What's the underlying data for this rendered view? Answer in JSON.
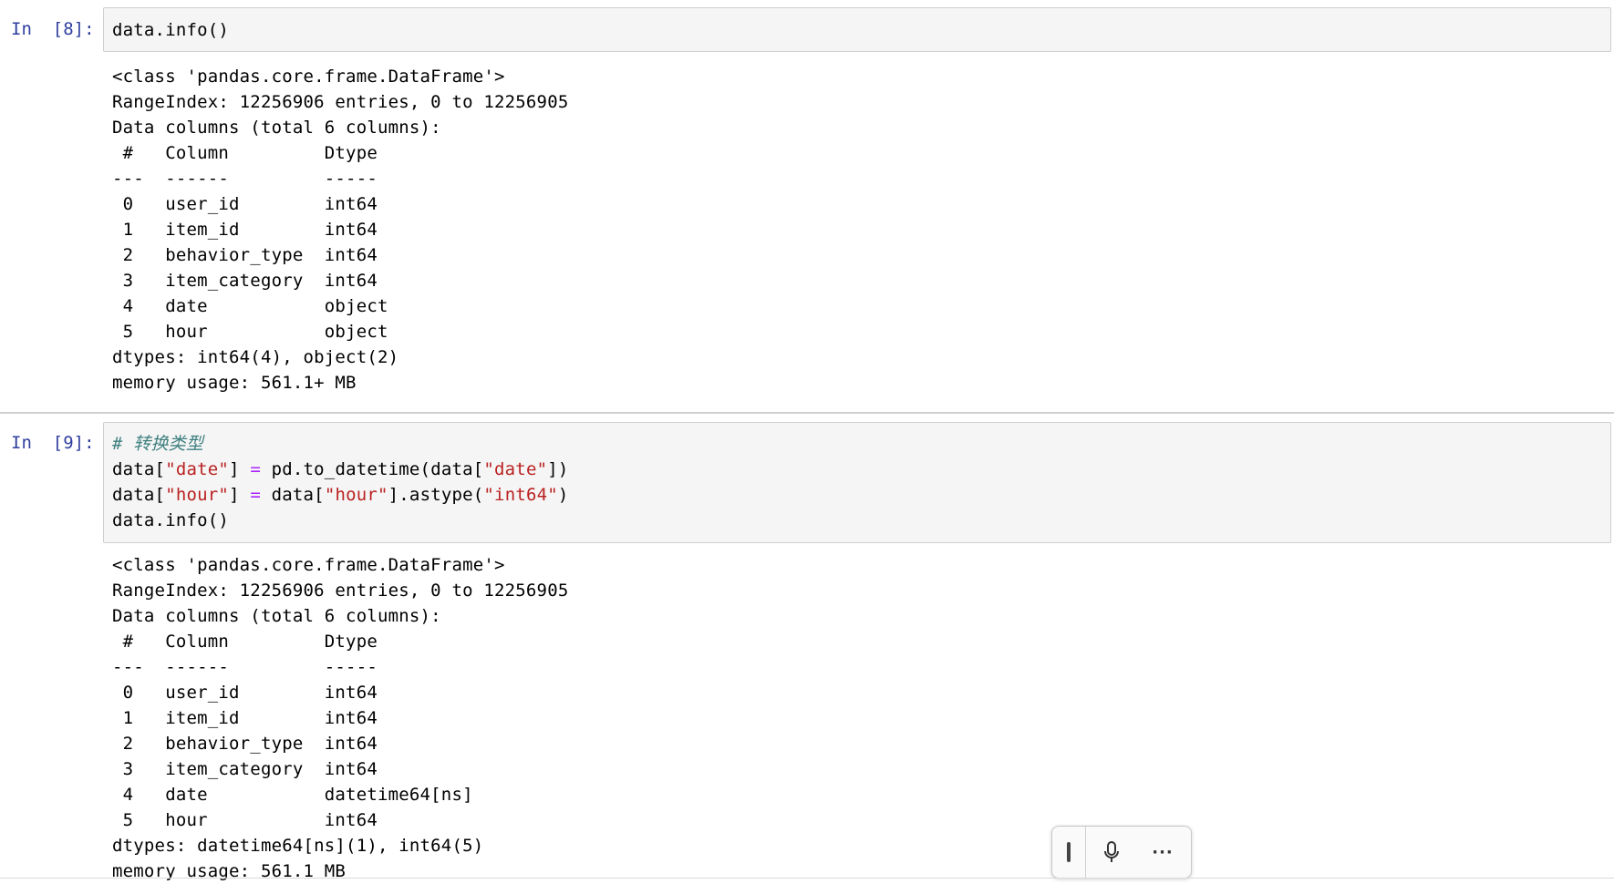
{
  "cells": [
    {
      "prompt": "In  [8]:",
      "input_lines": [
        [
          {
            "t": "data.info()",
            "c": ""
          }
        ]
      ],
      "output_lines": [
        "<class 'pandas.core.frame.DataFrame'>",
        "RangeIndex: 12256906 entries, 0 to 12256905",
        "Data columns (total 6 columns):",
        " #   Column         Dtype ",
        "---  ------         ----- ",
        " 0   user_id        int64 ",
        " 1   item_id        int64 ",
        " 2   behavior_type  int64 ",
        " 3   item_category  int64 ",
        " 4   date           object",
        " 5   hour           object",
        "dtypes: int64(4), object(2)",
        "memory usage: 561.1+ MB"
      ]
    },
    {
      "prompt": "In  [9]:",
      "input_lines": [
        [
          {
            "t": "# 转换类型",
            "c": "cm-comment"
          }
        ],
        [
          {
            "t": "data[",
            "c": ""
          },
          {
            "t": "\"date\"",
            "c": "cm-string"
          },
          {
            "t": "] ",
            "c": ""
          },
          {
            "t": "=",
            "c": "cm-op"
          },
          {
            "t": " pd.to_datetime(data[",
            "c": ""
          },
          {
            "t": "\"date\"",
            "c": "cm-string"
          },
          {
            "t": "])",
            "c": ""
          }
        ],
        [
          {
            "t": "data[",
            "c": ""
          },
          {
            "t": "\"hour\"",
            "c": "cm-string"
          },
          {
            "t": "] ",
            "c": ""
          },
          {
            "t": "=",
            "c": "cm-op"
          },
          {
            "t": " data[",
            "c": ""
          },
          {
            "t": "\"hour\"",
            "c": "cm-string"
          },
          {
            "t": "].astype(",
            "c": ""
          },
          {
            "t": "\"int64\"",
            "c": "cm-string"
          },
          {
            "t": ")",
            "c": ""
          }
        ],
        [
          {
            "t": "data.info()",
            "c": ""
          }
        ]
      ],
      "output_lines": [
        "<class 'pandas.core.frame.DataFrame'>",
        "RangeIndex: 12256906 entries, 0 to 12256905",
        "Data columns (total 6 columns):",
        " #   Column         Dtype         ",
        "---  ------         -----         ",
        " 0   user_id        int64         ",
        " 1   item_id        int64         ",
        " 2   behavior_type  int64         ",
        " 3   item_category  int64         ",
        " 4   date           datetime64[ns]",
        " 5   hour           int64         ",
        "dtypes: datetime64[ns](1), int64(5)",
        "memory usage: 561.1 MB"
      ]
    }
  ],
  "toolbar": {
    "handle_icon": "drag-handle-icon",
    "mic_icon": "microphone-icon",
    "more_label": "···"
  }
}
